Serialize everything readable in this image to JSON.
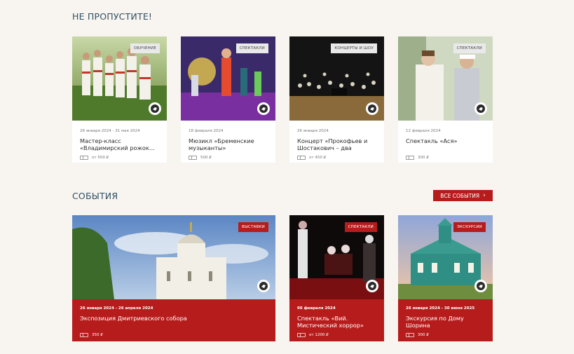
{
  "sections": {
    "dont_miss_title": "НЕ ПРОПУСТИТЕ!",
    "events_title": "СОБЫТИЯ",
    "all_events_label": "ВСЕ СОБЫТИЯ"
  },
  "top_cards": [
    {
      "badge": "ОБУЧЕНИЕ",
      "date": "26 января 2024 - 31 мая 2024",
      "title": "Мастер-класс «Владимирский рожок…",
      "price": "от 500 ₽"
    },
    {
      "badge": "СПЕКТАКЛИ",
      "date": "18 февраля 2024",
      "title": "Мюзикл «Бременские музыканты»",
      "price": "500 ₽"
    },
    {
      "badge": "КОНЦЕРТЫ И ШОУ",
      "date": "26 января 2024",
      "title": "Концерт «Прокофьев и Шостакович – два зеркала…",
      "price": "от 450 ₽"
    },
    {
      "badge": "СПЕКТАКЛИ",
      "date": "12 февраля 2024",
      "title": "Спектакль «Ася»",
      "price": "300 ₽"
    }
  ],
  "event_cards": [
    {
      "badge": "ВЫСТАВКИ",
      "date": "26 января 2024 - 26 апреля 2024",
      "title": "Экспозиция Дмитриевского собора",
      "price": "350 ₽"
    },
    {
      "badge": "СПЕКТАКЛИ",
      "date": "06 февраля 2024",
      "title": "Спектакль «Вий. Мистический хоррор»",
      "price": "от 1200 ₽"
    },
    {
      "badge": "ЭКСКУРСИИ",
      "date": "26 января 2024 - 30 июня 2025",
      "title": "Экскурсия по Дому Шорина",
      "price": "300 ₽"
    }
  ]
}
